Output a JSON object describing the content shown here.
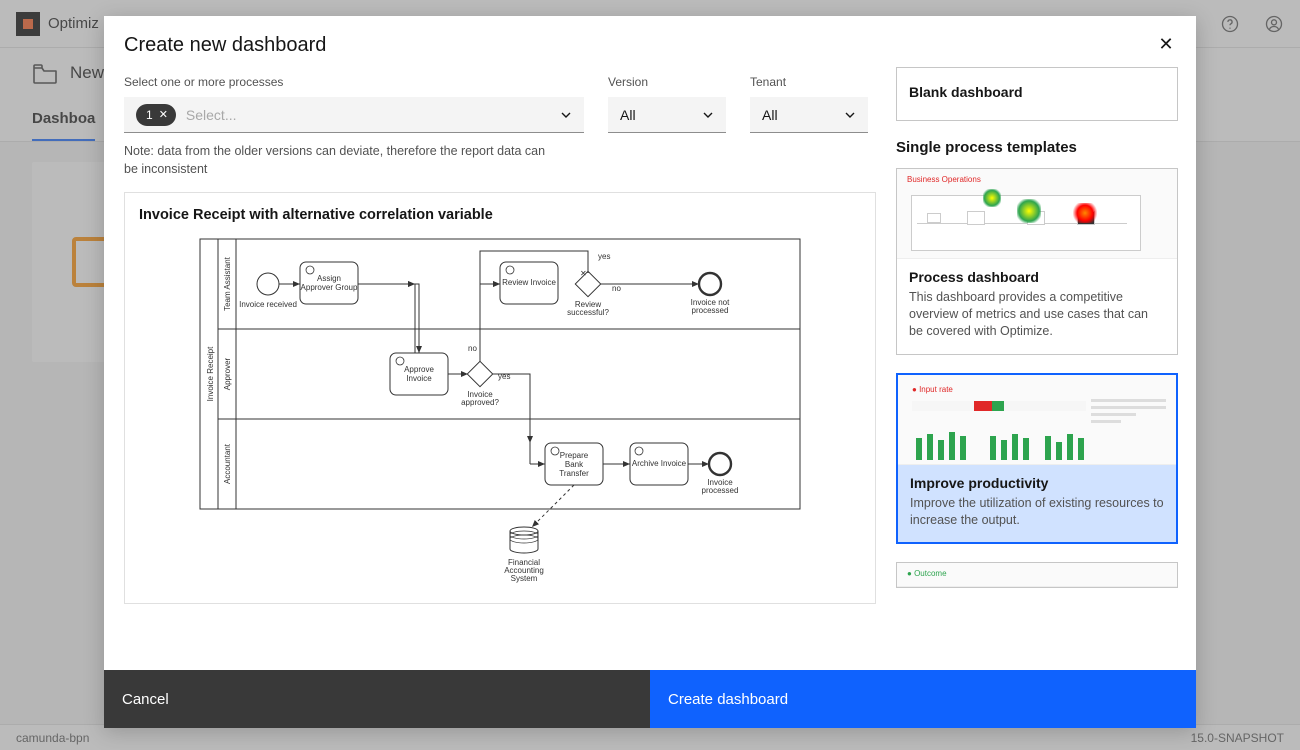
{
  "app": {
    "title_truncated": "Optimiz"
  },
  "breadcrumb": {
    "current": "New"
  },
  "tabs": {
    "active": "Dashboa"
  },
  "footer": {
    "left": "camunda-bpn",
    "right": "15.0-SNAPSHOT"
  },
  "modal": {
    "title": "Create new dashboard",
    "fields": {
      "process_label": "Select one or more processes",
      "process_count": "1",
      "process_placeholder": "Select...",
      "version_label": "Version",
      "version_value": "All",
      "tenant_label": "Tenant",
      "tenant_value": "All"
    },
    "note": "Note: data from the older versions can deviate, therefore the report data can be inconsistent",
    "diagram": {
      "title": "Invoice Receipt with alternative correlation variable",
      "pool": "Invoice Receipt",
      "lanes": [
        "Team Assistant",
        "Approver",
        "Accountant"
      ],
      "start_label": "Invoice received",
      "task_assign": "Assign Approver Group",
      "task_review": "Review Invoice",
      "gw_review_label": "Review successful?",
      "gw_review_yes": "yes",
      "gw_review_no": "no",
      "end_not_processed": "Invoice not processed",
      "task_approve": "Approve Invoice",
      "gw_approve_label": "Invoice approved?",
      "gw_approve_yes": "yes",
      "gw_approve_no": "no",
      "task_prepare": "Prepare Bank Transfer",
      "task_archive": "Archive Invoice",
      "end_processed": "Invoice processed",
      "datastore": "Financial Accounting System"
    },
    "templates": {
      "blank": "Blank dashboard",
      "section_single": "Single process templates",
      "process_db": {
        "title": "Process dashboard",
        "desc": "This dashboard provides a competitive overview of metrics and use cases that can be covered with Optimize.",
        "preview_label": "Business Operations"
      },
      "improve": {
        "title": "Improve productivity",
        "desc": "Improve the utilization of existing resources to increase the output.",
        "preview_label": "Input rate"
      },
      "third_preview_label": "Outcome"
    },
    "buttons": {
      "cancel": "Cancel",
      "create": "Create dashboard"
    }
  }
}
